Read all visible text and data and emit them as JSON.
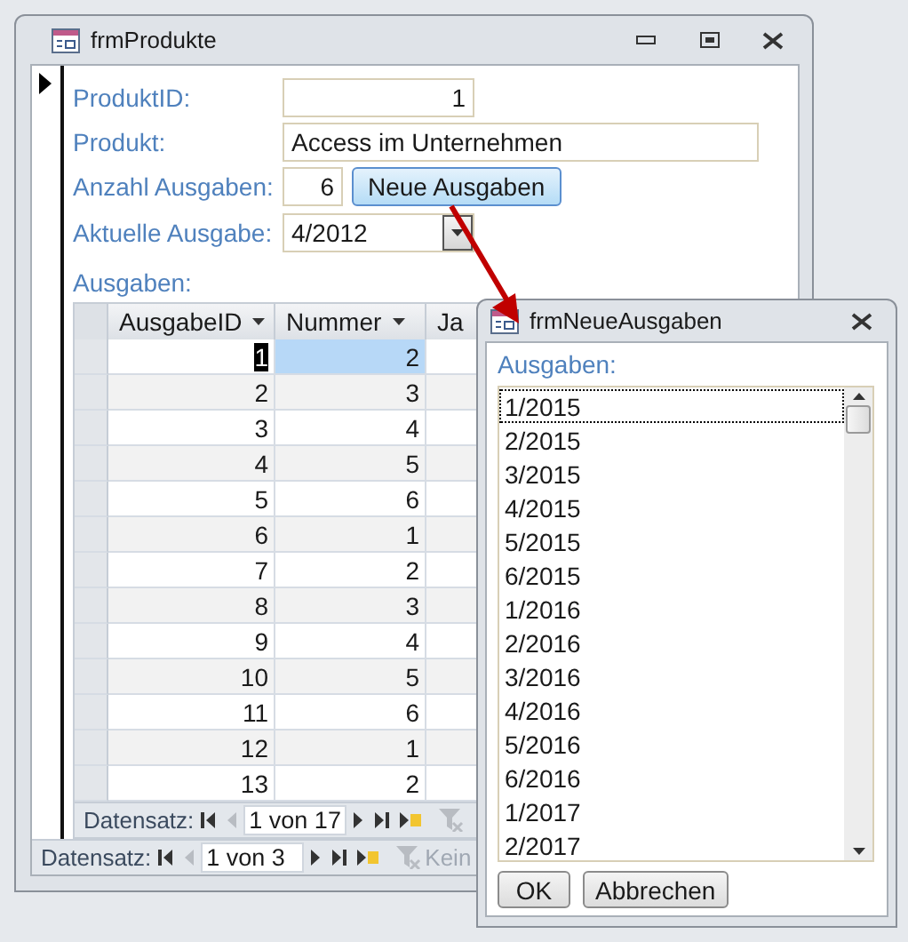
{
  "main_window": {
    "title": "frmProdukte",
    "fields": [
      {
        "kind": "number",
        "label": "ProduktID:",
        "value": "1"
      },
      {
        "kind": "text",
        "label": "Produkt:",
        "value": "Access im Unternehmen"
      },
      {
        "kind": "number_button",
        "label": "Anzahl Ausgaben:",
        "value": "6",
        "button": "Neue Ausgaben"
      },
      {
        "kind": "combo",
        "label": "Aktuelle Ausgabe:",
        "value": "4/2012"
      }
    ],
    "subform": {
      "label": "Ausgaben:",
      "columns": [
        {
          "label": "AusgabeID",
          "menu": true
        },
        {
          "label": "Nummer",
          "menu": true
        },
        {
          "label": "Ja",
          "menu": false
        }
      ],
      "rows": [
        {
          "cells": [
            "1",
            "2"
          ],
          "selected": true
        },
        {
          "cells": [
            "2",
            "3"
          ],
          "selected": false
        },
        {
          "cells": [
            "3",
            "4"
          ],
          "selected": false
        },
        {
          "cells": [
            "4",
            "5"
          ],
          "selected": false
        },
        {
          "cells": [
            "5",
            "6"
          ],
          "selected": false
        },
        {
          "cells": [
            "6",
            "1"
          ],
          "selected": false
        },
        {
          "cells": [
            "7",
            "2"
          ],
          "selected": false
        },
        {
          "cells": [
            "8",
            "3"
          ],
          "selected": false
        },
        {
          "cells": [
            "9",
            "4"
          ],
          "selected": false
        },
        {
          "cells": [
            "10",
            "5"
          ],
          "selected": false
        },
        {
          "cells": [
            "11",
            "6"
          ],
          "selected": false
        },
        {
          "cells": [
            "12",
            "1"
          ],
          "selected": false
        },
        {
          "cells": [
            "13",
            "2"
          ],
          "selected": false
        }
      ],
      "nav": {
        "label": "Datensatz:",
        "position": "1 von 17"
      }
    },
    "nav": {
      "label": "Datensatz:",
      "position": "1 von 3",
      "filter": "Kein"
    }
  },
  "dialog": {
    "title": "frmNeueAusgaben",
    "label": "Ausgaben:",
    "items": [
      {
        "text": "1/2015",
        "focused": true
      },
      {
        "text": "2/2015",
        "focused": false
      },
      {
        "text": "3/2015",
        "focused": false
      },
      {
        "text": "4/2015",
        "focused": false
      },
      {
        "text": "5/2015",
        "focused": false
      },
      {
        "text": "6/2015",
        "focused": false
      },
      {
        "text": "1/2016",
        "focused": false
      },
      {
        "text": "2/2016",
        "focused": false
      },
      {
        "text": "3/2016",
        "focused": false
      },
      {
        "text": "4/2016",
        "focused": false
      },
      {
        "text": "5/2016",
        "focused": false
      },
      {
        "text": "6/2016",
        "focused": false
      },
      {
        "text": "1/2017",
        "focused": false
      },
      {
        "text": "2/2017",
        "focused": false
      }
    ],
    "buttons": [
      "OK",
      "Abbrechen"
    ]
  }
}
